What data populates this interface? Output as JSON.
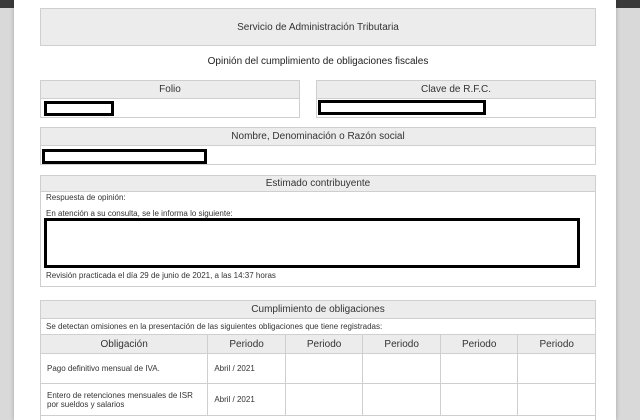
{
  "header": {
    "agency": "Servicio de Administración Tributaria",
    "subtitle": "Opinión del cumplimiento de obligaciones fiscales"
  },
  "folio": {
    "label": "Folio"
  },
  "rfc": {
    "label": "Clave de R.F.C."
  },
  "nombre": {
    "label": "Nombre, Denominación o Razón social"
  },
  "estimado": {
    "title": "Estimado contribuyente",
    "respuesta": "Respuesta de opinión:",
    "atencion": "En atención a su consulta, se le informa lo siguiente:",
    "revision": "Revisión practicada el día 29 de junio de 2021, a las 14:37 horas"
  },
  "cumplimiento": {
    "title": "Cumplimiento de obligaciones",
    "note": "Se detectan omisiones en la presentación de las siguientes obligaciones que tiene registradas:",
    "columns": [
      "Obligación",
      "Periodo",
      "Periodo",
      "Periodo",
      "Periodo",
      "Periodo"
    ],
    "rows": [
      {
        "obligacion": "Pago definitivo mensual de IVA.",
        "periodo": "Abril / 2021"
      },
      {
        "obligacion": "Entero de retenciones mensuales de ISR por sueldos y salarios",
        "periodo": "Abril / 2021"
      }
    ]
  }
}
